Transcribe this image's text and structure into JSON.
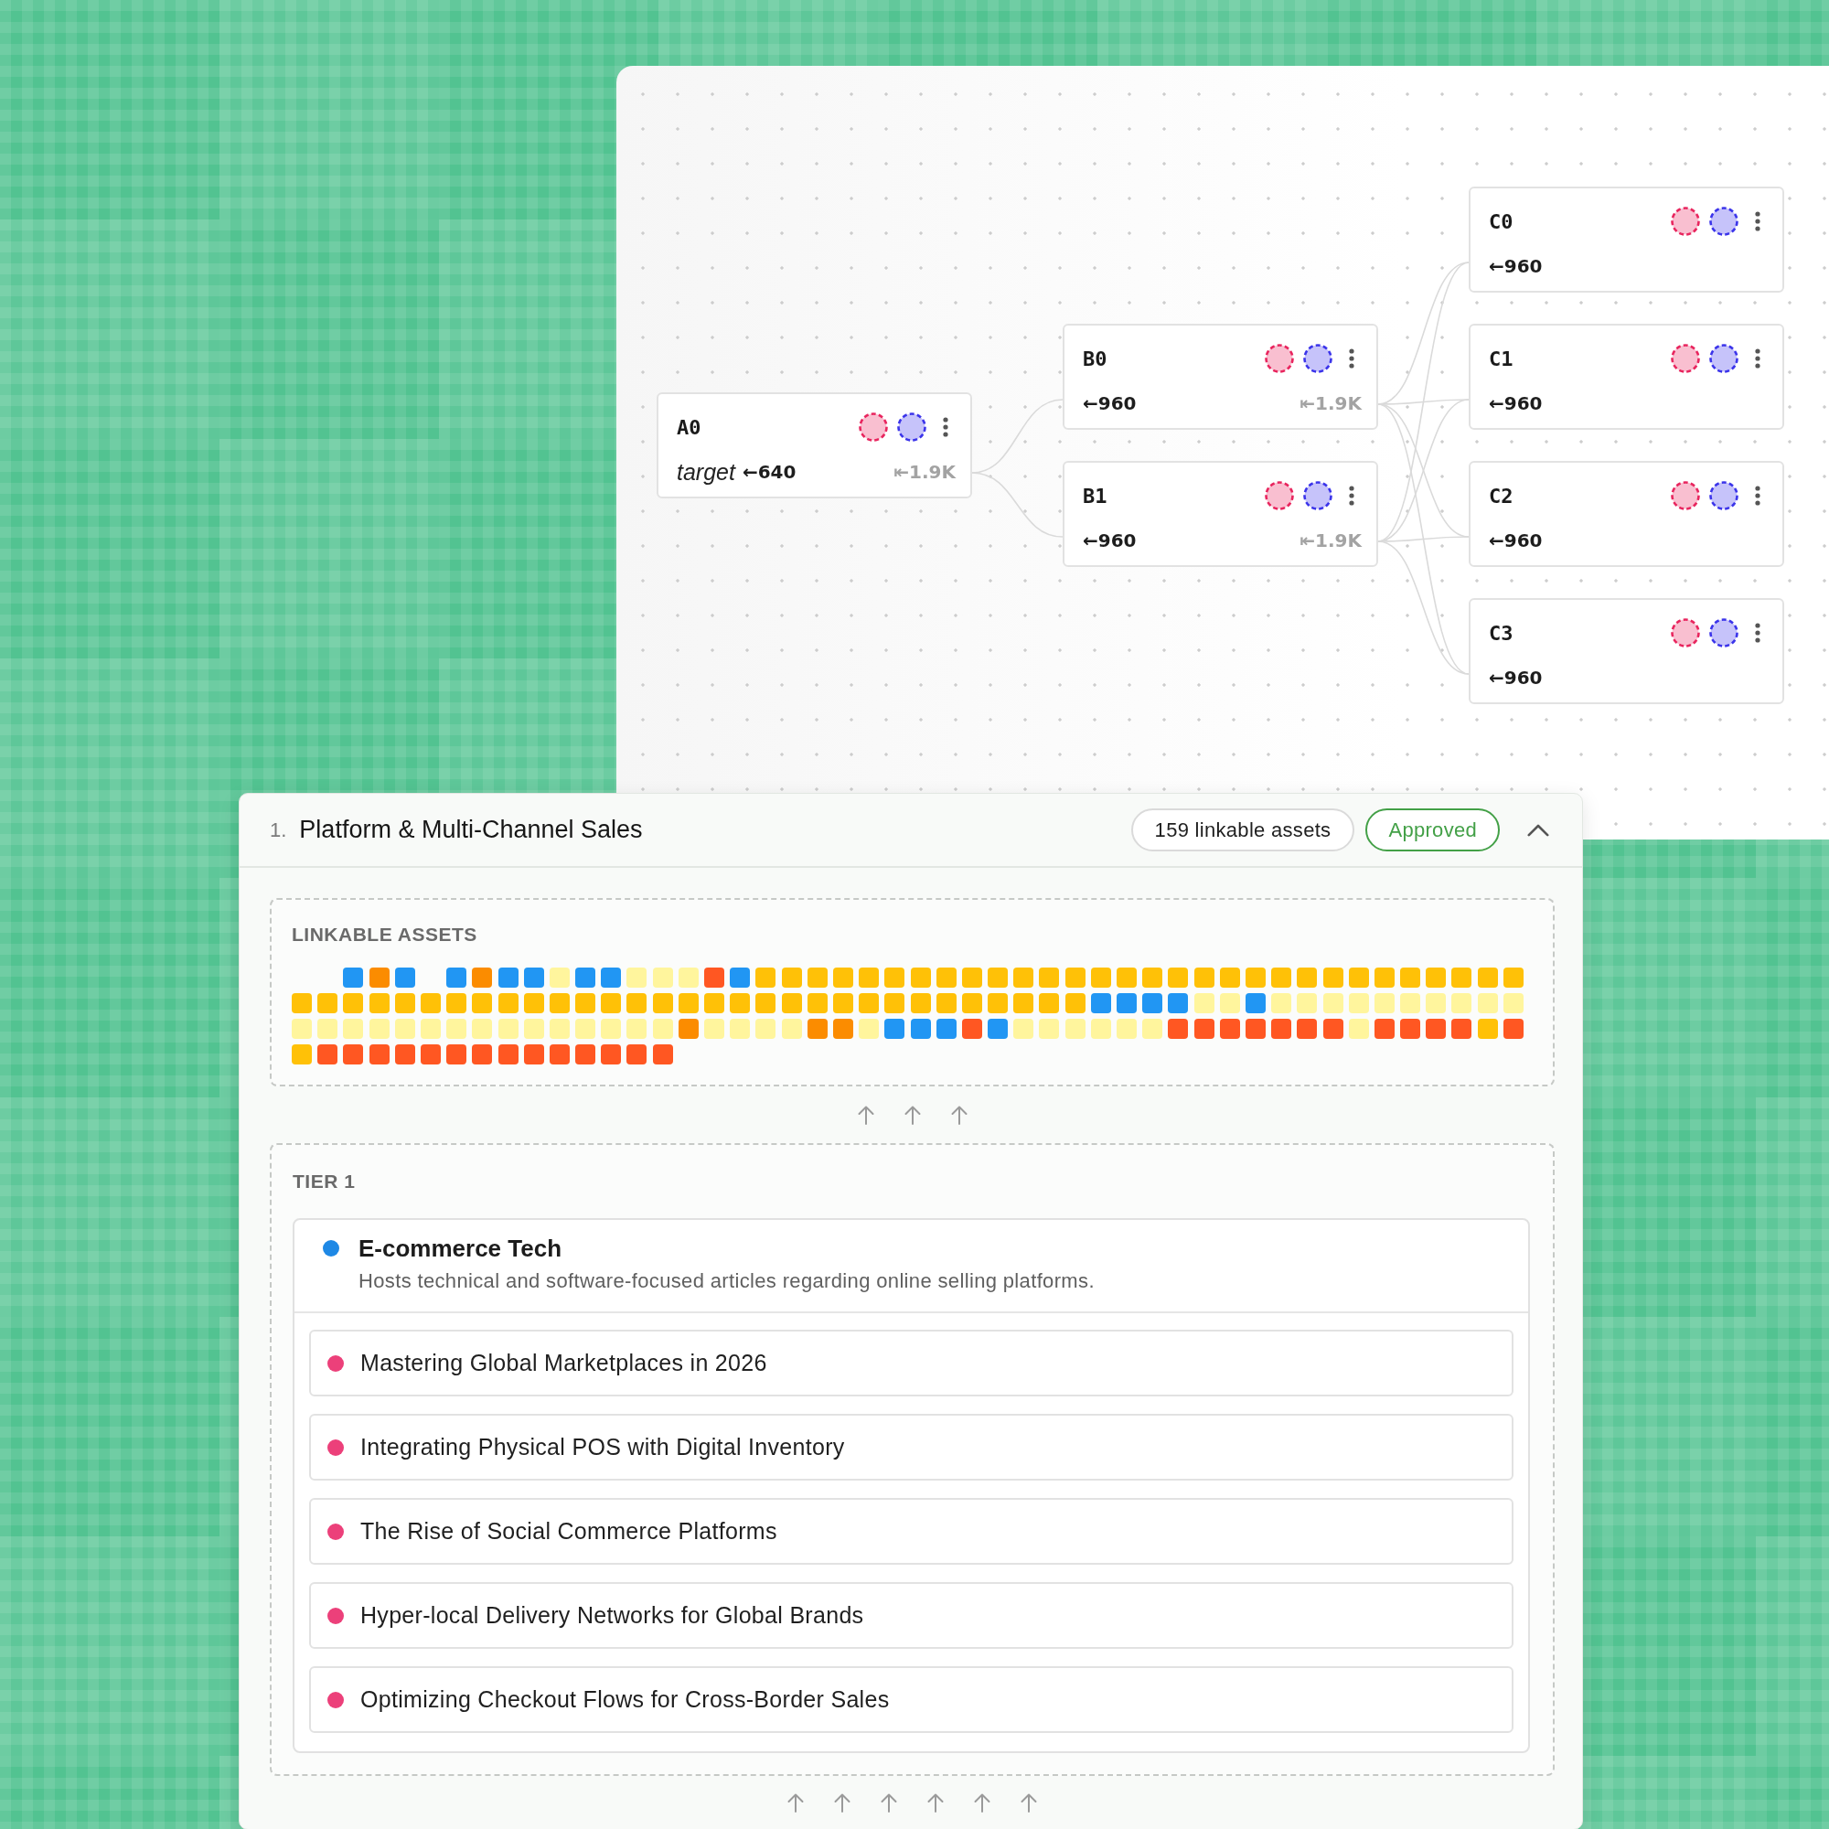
{
  "canvas": {
    "columns": [
      {
        "nodes": [
          {
            "title": "A0",
            "note": "target",
            "inbound": "←640",
            "outbound": "⇤1.9K"
          }
        ]
      },
      {
        "nodes": [
          {
            "title": "B0",
            "inbound": "←960",
            "outbound": "⇤1.9K"
          },
          {
            "title": "B1",
            "inbound": "←960",
            "outbound": "⇤1.9K"
          }
        ]
      },
      {
        "nodes": [
          {
            "title": "C0",
            "inbound": "←960"
          },
          {
            "title": "C1",
            "inbound": "←960"
          },
          {
            "title": "C2",
            "inbound": "←960"
          },
          {
            "title": "C3",
            "inbound": "←960"
          }
        ]
      }
    ]
  },
  "section": {
    "index": "1.",
    "title": "Platform & Multi-Channel Sales",
    "count": "159 linkable assets",
    "status": {
      "label": "Approved",
      "kind": "approved"
    },
    "expanded": true,
    "assets": {
      "label": "LINKABLE ASSETS",
      "tiles": [
        {
          "kind": "gap"
        },
        {
          "kind": "gap"
        },
        {
          "kind": "tile",
          "color": "#2196f3"
        },
        {
          "kind": "tile",
          "color": "#fb8c00"
        },
        {
          "kind": "tile",
          "color": "#2196f3"
        },
        {
          "kind": "gap"
        },
        {
          "kind": "tile",
          "color": "#2196f3"
        },
        {
          "kind": "tile",
          "color": "#fb8c00"
        },
        {
          "kind": "tile",
          "color": "#2196f3"
        },
        {
          "kind": "tile",
          "color": "#2196f3"
        },
        {
          "kind": "tile",
          "color": "#fff59d"
        },
        {
          "kind": "tile",
          "color": "#2196f3"
        },
        {
          "kind": "tile",
          "color": "#2196f3"
        },
        {
          "kind": "tile",
          "color": "#fff59d"
        },
        {
          "kind": "tile",
          "color": "#fff59d"
        },
        {
          "kind": "tile",
          "color": "#fff59d"
        },
        {
          "kind": "tile",
          "color": "#ff5722"
        },
        {
          "kind": "tile",
          "color": "#2196f3"
        },
        {
          "kind": "tile",
          "color": "#ffc107"
        },
        {
          "kind": "tile",
          "color": "#ffc107"
        },
        {
          "kind": "tile",
          "color": "#ffc107"
        },
        {
          "kind": "tile",
          "color": "#ffc107"
        },
        {
          "kind": "tile",
          "color": "#ffc107"
        },
        {
          "kind": "tile",
          "color": "#ffc107"
        },
        {
          "kind": "tile",
          "color": "#ffc107"
        },
        {
          "kind": "tile",
          "color": "#ffc107"
        },
        {
          "kind": "tile",
          "color": "#ffc107"
        },
        {
          "kind": "tile",
          "color": "#ffc107"
        },
        {
          "kind": "tile",
          "color": "#ffc107"
        },
        {
          "kind": "tile",
          "color": "#ffc107"
        },
        {
          "kind": "tile",
          "color": "#ffc107"
        },
        {
          "kind": "tile",
          "color": "#ffc107"
        },
        {
          "kind": "tile",
          "color": "#ffc107"
        },
        {
          "kind": "tile",
          "color": "#ffc107"
        },
        {
          "kind": "tile",
          "color": "#ffc107"
        },
        {
          "kind": "tile",
          "color": "#ffc107"
        },
        {
          "kind": "tile",
          "color": "#ffc107"
        },
        {
          "kind": "tile",
          "color": "#ffc107"
        },
        {
          "kind": "tile",
          "color": "#ffc107"
        },
        {
          "kind": "tile",
          "color": "#ffc107"
        },
        {
          "kind": "tile",
          "color": "#ffc107"
        },
        {
          "kind": "tile",
          "color": "#ffc107"
        },
        {
          "kind": "tile",
          "color": "#ffc107"
        },
        {
          "kind": "tile",
          "color": "#ffc107"
        },
        {
          "kind": "tile",
          "color": "#ffc107"
        },
        {
          "kind": "tile",
          "color": "#ffc107"
        },
        {
          "kind": "tile",
          "color": "#ffc107"
        },
        {
          "kind": "tile",
          "color": "#ffc107"
        },
        {
          "kind": "tile",
          "color": "#ffc107"
        },
        {
          "kind": "tile",
          "color": "#ffc107"
        },
        {
          "kind": "tile",
          "color": "#ffc107"
        },
        {
          "kind": "tile",
          "color": "#ffc107"
        },
        {
          "kind": "tile",
          "color": "#ffc107"
        },
        {
          "kind": "tile",
          "color": "#ffc107"
        },
        {
          "kind": "tile",
          "color": "#ffc107"
        },
        {
          "kind": "tile",
          "color": "#ffc107"
        },
        {
          "kind": "tile",
          "color": "#ffc107"
        },
        {
          "kind": "tile",
          "color": "#ffc107"
        },
        {
          "kind": "tile",
          "color": "#ffc107"
        },
        {
          "kind": "tile",
          "color": "#ffc107"
        },
        {
          "kind": "tile",
          "color": "#ffc107"
        },
        {
          "kind": "tile",
          "color": "#ffc107"
        },
        {
          "kind": "tile",
          "color": "#ffc107"
        },
        {
          "kind": "tile",
          "color": "#ffc107"
        },
        {
          "kind": "tile",
          "color": "#ffc107"
        },
        {
          "kind": "tile",
          "color": "#ffc107"
        },
        {
          "kind": "tile",
          "color": "#ffc107"
        },
        {
          "kind": "tile",
          "color": "#ffc107"
        },
        {
          "kind": "tile",
          "color": "#ffc107"
        },
        {
          "kind": "tile",
          "color": "#ffc107"
        },
        {
          "kind": "tile",
          "color": "#ffc107"
        },
        {
          "kind": "tile",
          "color": "#ffc107"
        },
        {
          "kind": "tile",
          "color": "#ffc107"
        },
        {
          "kind": "tile",
          "color": "#ffc107"
        },
        {
          "kind": "tile",
          "color": "#ffc107"
        },
        {
          "kind": "tile",
          "color": "#ffc107"
        },
        {
          "kind": "tile",
          "color": "#ffc107"
        },
        {
          "kind": "tile",
          "color": "#ffc107"
        },
        {
          "kind": "tile",
          "color": "#ffc107"
        },
        {
          "kind": "tile",
          "color": "#2196f3"
        },
        {
          "kind": "tile",
          "color": "#2196f3"
        },
        {
          "kind": "tile",
          "color": "#2196f3"
        },
        {
          "kind": "tile",
          "color": "#2196f3"
        },
        {
          "kind": "tile",
          "color": "#fff59d"
        },
        {
          "kind": "tile",
          "color": "#fff59d"
        },
        {
          "kind": "tile",
          "color": "#2196f3"
        },
        {
          "kind": "tile",
          "color": "#fff59d"
        },
        {
          "kind": "tile",
          "color": "#fff59d"
        },
        {
          "kind": "tile",
          "color": "#fff59d"
        },
        {
          "kind": "tile",
          "color": "#fff59d"
        },
        {
          "kind": "tile",
          "color": "#fff59d"
        },
        {
          "kind": "tile",
          "color": "#fff59d"
        },
        {
          "kind": "tile",
          "color": "#fff59d"
        },
        {
          "kind": "tile",
          "color": "#fff59d"
        },
        {
          "kind": "tile",
          "color": "#fff59d"
        },
        {
          "kind": "tile",
          "color": "#fff59d"
        },
        {
          "kind": "tile",
          "color": "#fff59d"
        },
        {
          "kind": "tile",
          "color": "#fff59d"
        },
        {
          "kind": "tile",
          "color": "#fff59d"
        },
        {
          "kind": "tile",
          "color": "#fff59d"
        },
        {
          "kind": "tile",
          "color": "#fff59d"
        },
        {
          "kind": "tile",
          "color": "#fff59d"
        },
        {
          "kind": "tile",
          "color": "#fff59d"
        },
        {
          "kind": "tile",
          "color": "#fff59d"
        },
        {
          "kind": "tile",
          "color": "#fff59d"
        },
        {
          "kind": "tile",
          "color": "#fff59d"
        },
        {
          "kind": "tile",
          "color": "#fff59d"
        },
        {
          "kind": "tile",
          "color": "#fff59d"
        },
        {
          "kind": "tile",
          "color": "#fff59d"
        },
        {
          "kind": "tile",
          "color": "#fff59d"
        },
        {
          "kind": "tile",
          "color": "#fff59d"
        },
        {
          "kind": "tile",
          "color": "#fb8c00"
        },
        {
          "kind": "tile",
          "color": "#fff59d"
        },
        {
          "kind": "tile",
          "color": "#fff59d"
        },
        {
          "kind": "tile",
          "color": "#fff59d"
        },
        {
          "kind": "tile",
          "color": "#fff59d"
        },
        {
          "kind": "tile",
          "color": "#fb8c00"
        },
        {
          "kind": "tile",
          "color": "#fb8c00"
        },
        {
          "kind": "tile",
          "color": "#fff59d"
        },
        {
          "kind": "tile",
          "color": "#2196f3"
        },
        {
          "kind": "tile",
          "color": "#2196f3"
        },
        {
          "kind": "tile",
          "color": "#2196f3"
        },
        {
          "kind": "tile",
          "color": "#ff5722"
        },
        {
          "kind": "tile",
          "color": "#2196f3"
        },
        {
          "kind": "tile",
          "color": "#fff59d"
        },
        {
          "kind": "tile",
          "color": "#fff59d"
        },
        {
          "kind": "tile",
          "color": "#fff59d"
        },
        {
          "kind": "tile",
          "color": "#fff59d"
        },
        {
          "kind": "tile",
          "color": "#fff59d"
        },
        {
          "kind": "tile",
          "color": "#fff59d"
        },
        {
          "kind": "tile",
          "color": "#ff5722"
        },
        {
          "kind": "tile",
          "color": "#ff5722"
        },
        {
          "kind": "tile",
          "color": "#ff5722"
        },
        {
          "kind": "tile",
          "color": "#ff5722"
        },
        {
          "kind": "tile",
          "color": "#ff5722"
        },
        {
          "kind": "tile",
          "color": "#ff5722"
        },
        {
          "kind": "tile",
          "color": "#ff5722"
        },
        {
          "kind": "tile",
          "color": "#fff59d"
        },
        {
          "kind": "tile",
          "color": "#ff5722"
        },
        {
          "kind": "tile",
          "color": "#ff5722"
        },
        {
          "kind": "tile",
          "color": "#ff5722"
        },
        {
          "kind": "tile",
          "color": "#ff5722"
        },
        {
          "kind": "tile",
          "color": "#ffc107"
        },
        {
          "kind": "tile",
          "color": "#ff5722"
        },
        {
          "kind": "tile",
          "color": "#ffc107"
        },
        {
          "kind": "tile",
          "color": "#ff5722"
        },
        {
          "kind": "tile",
          "color": "#ff5722"
        },
        {
          "kind": "tile",
          "color": "#ff5722"
        },
        {
          "kind": "tile",
          "color": "#ff5722"
        },
        {
          "kind": "tile",
          "color": "#ff5722"
        },
        {
          "kind": "tile",
          "color": "#ff5722"
        },
        {
          "kind": "tile",
          "color": "#ff5722"
        },
        {
          "kind": "tile",
          "color": "#ff5722"
        },
        {
          "kind": "tile",
          "color": "#ff5722"
        },
        {
          "kind": "tile",
          "color": "#ff5722"
        },
        {
          "kind": "tile",
          "color": "#ff5722"
        },
        {
          "kind": "tile",
          "color": "#ff5722"
        },
        {
          "kind": "tile",
          "color": "#ff5722"
        },
        {
          "kind": "tile",
          "color": "#ff5722"
        }
      ]
    },
    "tiers": [
      {
        "label": "TIER 1",
        "sites": [
          {
            "name": "E-commerce Tech",
            "description": "Hosts technical and software-focused articles regarding online selling platforms.",
            "color": "#1e88e5",
            "articles": [
              {
                "title": "Mastering Global Marketplaces in 2026",
                "color": "#ec407a"
              },
              {
                "title": "Integrating Physical POS with Digital Inventory",
                "color": "#ec407a"
              },
              {
                "title": "The Rise of Social Commerce Platforms",
                "color": "#ec407a"
              },
              {
                "title": "Hyper-local Delivery Networks for Global Brands",
                "color": "#ec407a"
              },
              {
                "title": "Optimizing Checkout Flows for Cross-Border Sales",
                "color": "#ec407a"
              }
            ]
          }
        ]
      }
    ]
  }
}
